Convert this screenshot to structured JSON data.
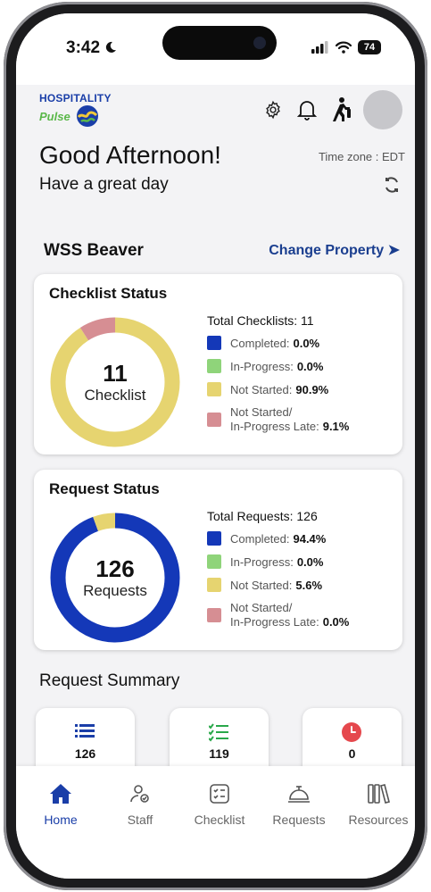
{
  "status_bar": {
    "time": "3:42",
    "battery": "74"
  },
  "header": {
    "logo_line1": "HOSPITALITY",
    "logo_line2": "Pulse",
    "icons": [
      "gear-icon",
      "bell-icon",
      "walking-person-icon"
    ]
  },
  "greeting": {
    "title": "Good Afternoon!",
    "subtitle": "Have a great day",
    "timezone": "Time zone : EDT"
  },
  "property": {
    "name": "WSS Beaver",
    "change_label": "Change Property ➤"
  },
  "checklist_status": {
    "title": "Checklist Status",
    "total_label": "Total Checklists: 11",
    "center_number": "11",
    "center_label": "Checklist",
    "segments": [
      {
        "label": "Completed:",
        "value": "0.0%",
        "percent": 0.0,
        "color": "#1438b8"
      },
      {
        "label": "In-Progress:",
        "value": "0.0%",
        "percent": 0.0,
        "color": "#8fd47a"
      },
      {
        "label": "Not Started:",
        "value": "90.9%",
        "percent": 90.9,
        "color": "#e6d470"
      },
      {
        "label": "Not Started/",
        "label2": "In-Progress Late:",
        "value": "9.1%",
        "percent": 9.1,
        "color": "#d68e93"
      }
    ]
  },
  "request_status": {
    "title": "Request Status",
    "total_label": "Total Requests: 126",
    "center_number": "126",
    "center_label": "Requests",
    "segments": [
      {
        "label": "Completed:",
        "value": "94.4%",
        "percent": 94.4,
        "color": "#1438b8"
      },
      {
        "label": "In-Progress:",
        "value": "0.0%",
        "percent": 0.0,
        "color": "#8fd47a"
      },
      {
        "label": "Not Started:",
        "value": "5.6%",
        "percent": 5.6,
        "color": "#e6d470"
      },
      {
        "label": "Not Started/",
        "label2": "In-Progress Late:",
        "value": "0.0%",
        "percent": 0.0,
        "color": "#d68e93"
      }
    ]
  },
  "request_summary": {
    "title": "Request Summary",
    "cards": [
      {
        "value": "126",
        "icon": "list-icon"
      },
      {
        "value": "119",
        "icon": "checklist-icon"
      },
      {
        "value": "0",
        "icon": "clock-icon"
      }
    ]
  },
  "tabs": [
    {
      "label": "Home",
      "icon": "home-icon",
      "active": true
    },
    {
      "label": "Staff",
      "icon": "staff-icon",
      "active": false
    },
    {
      "label": "Checklist",
      "icon": "checklist-icon",
      "active": false
    },
    {
      "label": "Requests",
      "icon": "service-bell-icon",
      "active": false
    },
    {
      "label": "Resources",
      "icon": "books-icon",
      "active": false
    }
  ]
}
